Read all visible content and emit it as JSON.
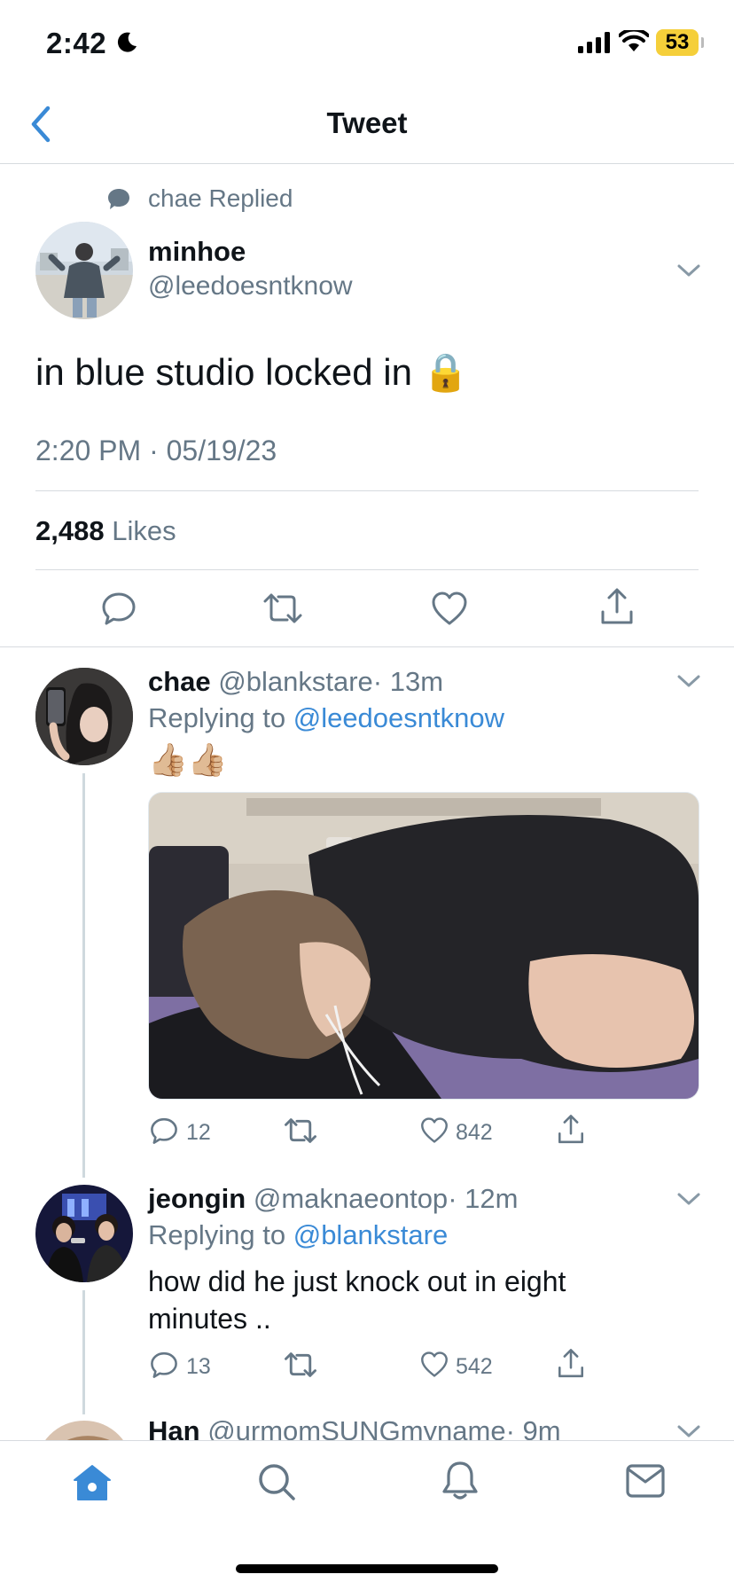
{
  "status_bar": {
    "time": "2:42",
    "battery": "53"
  },
  "nav": {
    "title": "Tweet"
  },
  "main_tweet": {
    "social_context": "chae Replied",
    "author_name": "minhoe",
    "author_handle": "@leedoesntknow",
    "text": "in blue studio locked in 🔒",
    "timestamp": "2:20 PM · 05/19/23",
    "likes_count": "2,488",
    "likes_label": "Likes"
  },
  "replies": [
    {
      "author_name": "chae",
      "author_handle": "@blankstare",
      "time": "· 13m",
      "replying_prefix": "Replying to",
      "replying_to": "@leedoesntknow",
      "text": "👍🏼👍🏼",
      "has_media": true,
      "reply_count": "12",
      "retweet_count": "",
      "like_count": "842"
    },
    {
      "author_name": "jeongin",
      "author_handle": "@maknaeontop",
      "time": "· 12m",
      "replying_prefix": "Replying to",
      "replying_to": "@blankstare",
      "text": "how did he just knock out in eight minutes ..",
      "reply_count": "13",
      "retweet_count": "",
      "like_count": "542"
    },
    {
      "author_name": "Han",
      "author_handle": "@urmomSUNGmyname",
      "time": "· 9m"
    }
  ],
  "tab_bar": {
    "items": [
      "home-icon",
      "search-icon",
      "notifications-icon",
      "messages-icon"
    ],
    "active": "home-icon"
  },
  "colors": {
    "accent": "#3a8ad6",
    "muted": "#657786",
    "battery": "#f5cf3a"
  }
}
